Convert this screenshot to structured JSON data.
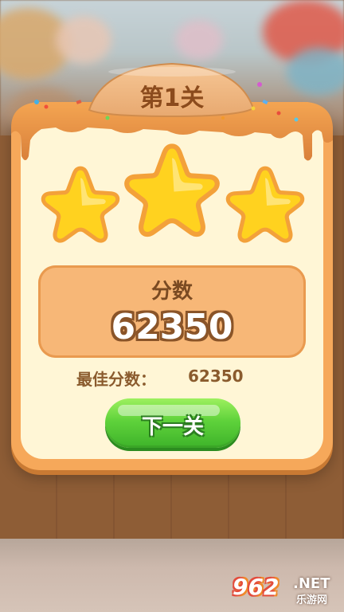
{
  "level_title": "第1关",
  "stars": {
    "earned": 3,
    "total": 3
  },
  "score": {
    "label": "分数",
    "value": "62350"
  },
  "best": {
    "label": "最佳分数：",
    "value": "62350"
  },
  "next_button": {
    "label": "下一关"
  },
  "watermark": {
    "number": "962",
    "suffix": ".NET",
    "sub": "乐游网"
  },
  "colors": {
    "panel_orange": "#f6a85a",
    "panel_cream": "#fff6d6",
    "caramel": "#e0903d",
    "button_green": "#5fd23b",
    "star_yellow": "#ffd21f",
    "text_brown": "#8a5b2d"
  }
}
